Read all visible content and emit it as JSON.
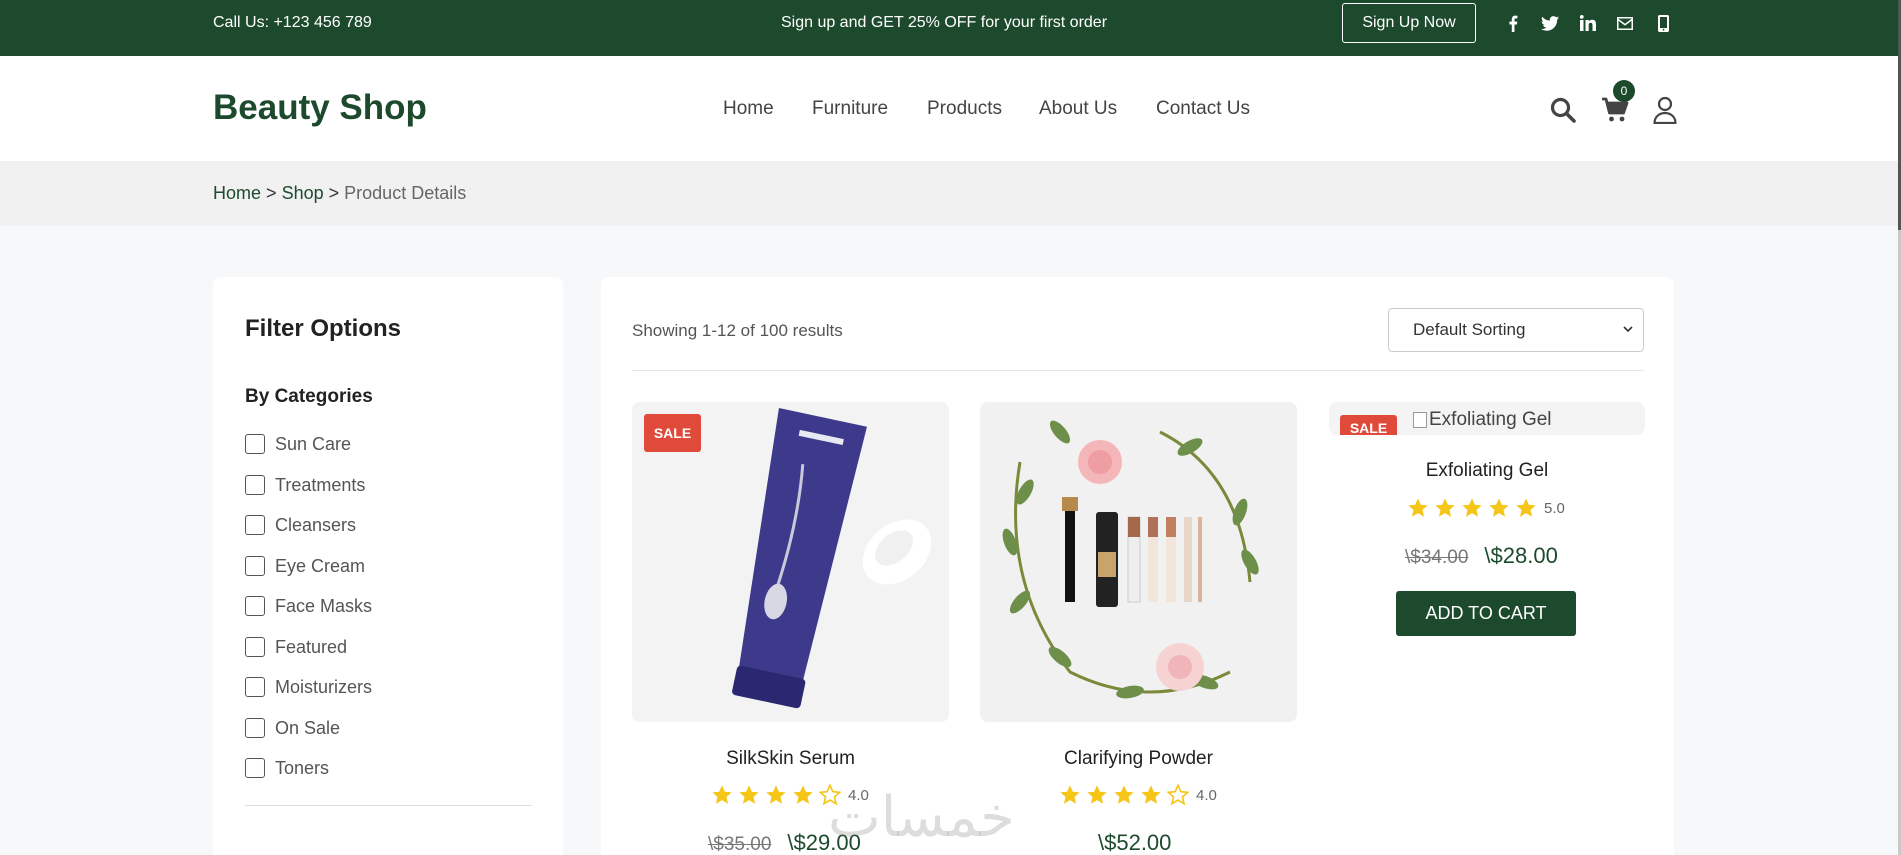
{
  "topbar": {
    "call": "Call Us: +123 456 789",
    "promo": "Sign up and GET 25% OFF for your first order",
    "signup_button": "Sign Up Now",
    "social_icons": [
      "facebook-icon",
      "twitter-icon",
      "linkedin-icon",
      "email-icon",
      "phone-icon"
    ]
  },
  "header": {
    "logo": "Beauty Shop",
    "nav": [
      "Home",
      "Furniture",
      "Products",
      "About Us",
      "Contact Us"
    ],
    "cart_count": "0",
    "icons": [
      "search-icon",
      "cart-icon",
      "user-icon"
    ]
  },
  "breadcrumb": {
    "home": "Home",
    "sep": ">",
    "shop": "Shop",
    "current": "Product Details"
  },
  "sidebar": {
    "title": "Filter Options",
    "section": "By Categories",
    "categories": [
      "Sun Care",
      "Treatments",
      "Cleansers",
      "Eye Cream",
      "Face Masks",
      "Featured",
      "Moisturizers",
      "On Sale",
      "Toners"
    ]
  },
  "main": {
    "showing": "Showing 1-12 of 100 results",
    "sort_selected": "Default Sorting",
    "sale_label": "SALE",
    "add_to_cart": "ADD TO CART",
    "products": [
      {
        "name": "SilkSkin Serum",
        "rating": 4,
        "rating_text": "4.0",
        "old_price": "\\$35.00",
        "price": "\\$29.00",
        "sale": true
      },
      {
        "name": "Clarifying Powder",
        "rating": 4,
        "rating_text": "4.0",
        "old_price": "",
        "price": "\\$52.00",
        "sale": false
      },
      {
        "name": "Exfoliating Gel",
        "rating": 5,
        "rating_text": "5.0",
        "old_price": "\\$34.00",
        "price": "\\$28.00",
        "sale": true,
        "image_alt": "Exfoliating Gel"
      }
    ]
  },
  "watermark": "خمسات",
  "colors": {
    "brand_green": "#1d4a2c",
    "sale_red": "#e04a3a",
    "star_gold": "#f5c518"
  }
}
